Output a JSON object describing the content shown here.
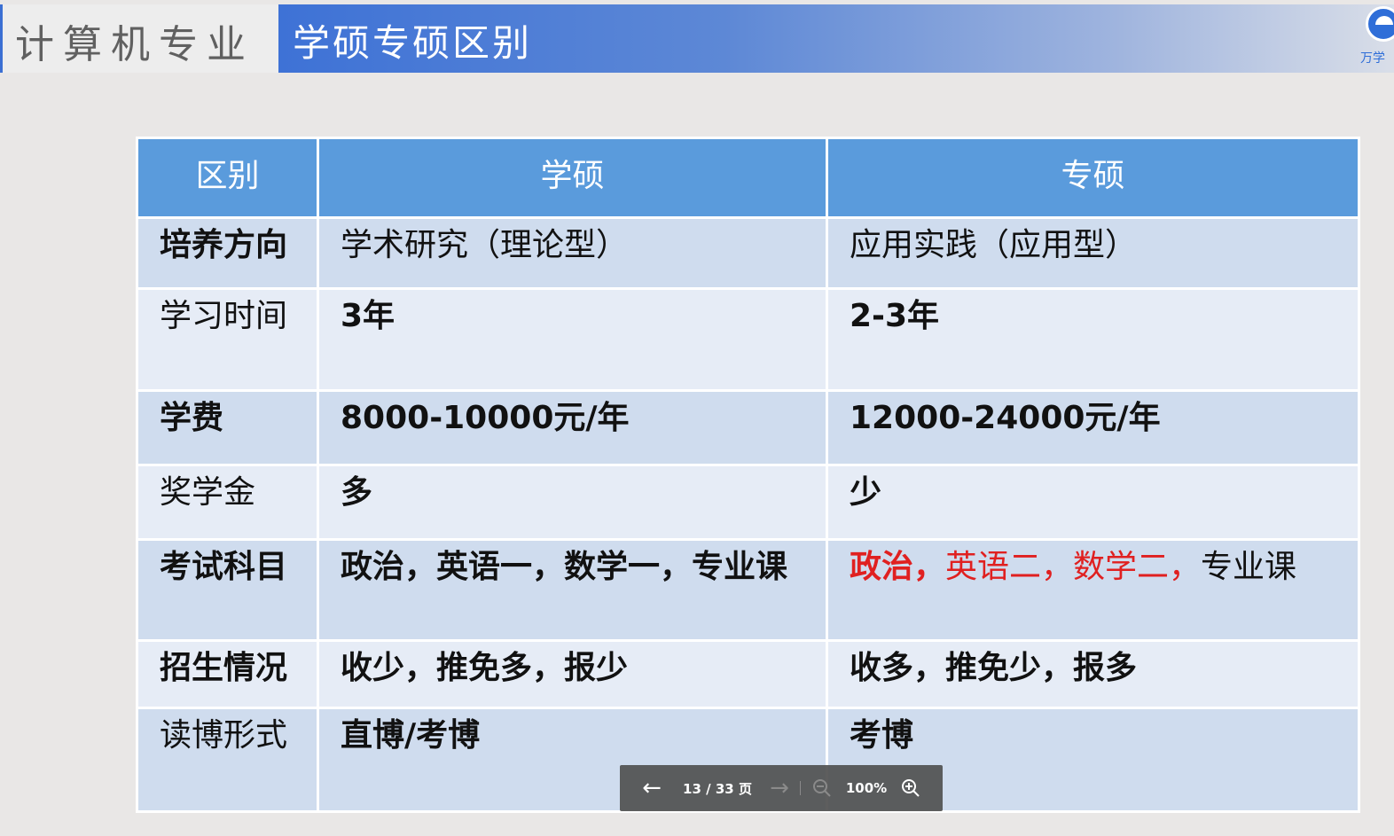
{
  "header": {
    "brand": "计算机专业",
    "title": "学硕专硕区别",
    "logo_text": "万学",
    "accent_color": "#3e72d6"
  },
  "table": {
    "columns": [
      "区别",
      "学硕",
      "专硕"
    ],
    "rows": [
      {
        "label": "培养方向",
        "xueshuo": "学术研究（理论型）",
        "zhuanshuo": "应用实践（应用型）"
      },
      {
        "label": "学习时间",
        "xueshuo": "3年",
        "zhuanshuo": "2-3年"
      },
      {
        "label": "学费",
        "xueshuo": "8000-10000元/年",
        "zhuanshuo": "12000-24000元/年"
      },
      {
        "label": "奖学金",
        "xueshuo": "多",
        "zhuanshuo": "少"
      },
      {
        "label": "考试科目",
        "xueshuo": "政治，英语一，数学一，专业课",
        "zhuanshuo_parts": [
          "政治，",
          "英语二，",
          "数学二，",
          "专业课"
        ]
      },
      {
        "label": "招生情况",
        "xueshuo": "收少，推免多，报少",
        "zhuanshuo": "收多，推免少，报多"
      },
      {
        "label": "读博形式",
        "xueshuo": "直博/考博",
        "zhuanshuo": "考博"
      }
    ]
  },
  "viewer": {
    "page_label": "13 / 33 页",
    "zoom_label": "100%",
    "icons": {
      "prev": "arrow-left-icon",
      "next": "arrow-right-icon",
      "zoom_out": "zoom-out-icon",
      "zoom_in": "zoom-in-icon"
    }
  }
}
